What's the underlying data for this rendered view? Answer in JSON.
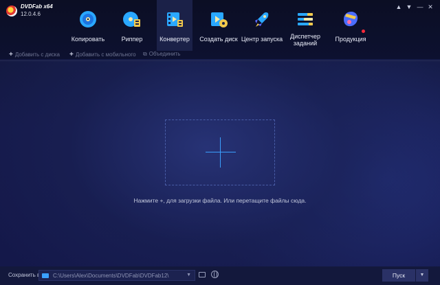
{
  "app": {
    "name": "DVDFab x64",
    "version": "12.0.4.6"
  },
  "window_controls": [
    "shirt-icon",
    "pin-icon",
    "minimize-icon",
    "close-icon"
  ],
  "toolbar": {
    "items": [
      {
        "label": "Копировать",
        "icon": "disc-copy-icon",
        "active": false
      },
      {
        "label": "Риппер",
        "icon": "disc-ripper-icon",
        "active": false
      },
      {
        "label": "Конвертер",
        "icon": "film-converter-icon",
        "active": true
      },
      {
        "label": "Создать диск",
        "icon": "disc-creator-icon",
        "active": false
      },
      {
        "label": "Центр запуска",
        "icon": "rocket-icon",
        "active": false
      },
      {
        "label": "Диспетчер заданий",
        "icon": "task-manager-icon",
        "active": false
      },
      {
        "label": "Продукция",
        "icon": "products-icon",
        "active": false,
        "badge": true
      }
    ]
  },
  "subbar": {
    "add_disc": "Добавить с диска",
    "add_mobile": "Добавить с мобильного",
    "merge": "Объединить"
  },
  "main": {
    "hint": "Нажмите +, для загрузки файла. Или перетащите файлы сюда."
  },
  "bottom": {
    "save_label": "Сохранить в:",
    "path": "C:\\Users\\Alex\\Documents\\DVDFab\\DVDFab12\\",
    "start_label": "Пуск"
  },
  "colors": {
    "accent": "#3aa0ff",
    "badge": "#ff2a3a"
  }
}
